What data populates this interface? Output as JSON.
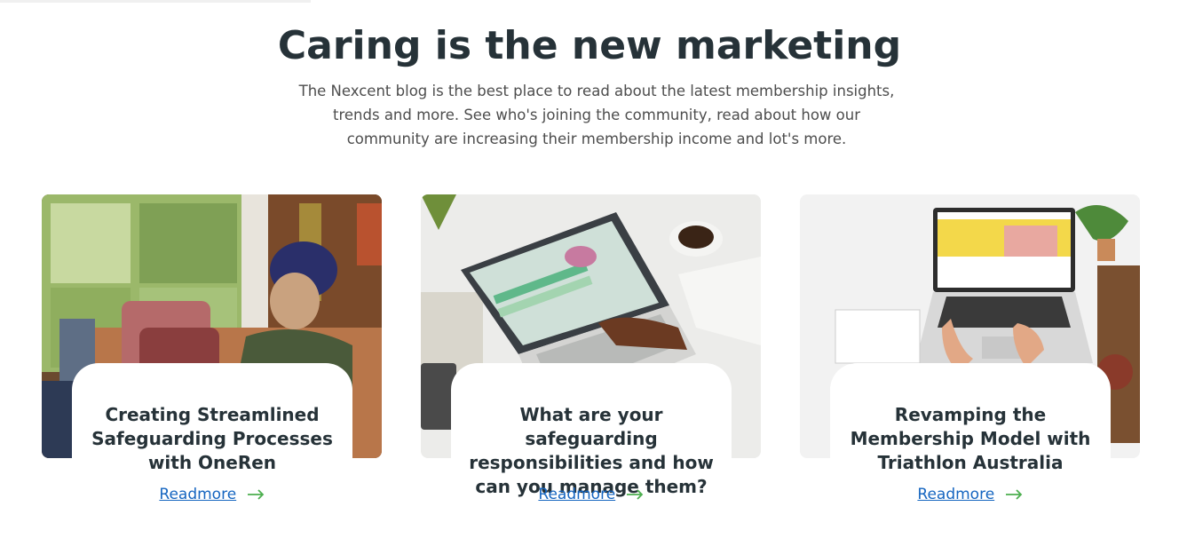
{
  "section": {
    "title": "Caring is the new marketing",
    "subtitle": "The Nexcent blog is the best place to read about the latest membership insights, trends and more. See who's joining the community, read about how our community are increasing their membership income and lot's more."
  },
  "cards": [
    {
      "title": "Creating Streamlined Safeguarding Processes with OneRen",
      "link_label": "Readmore"
    },
    {
      "title": "What are your safeguarding responsibilities and how can you manage them?",
      "link_label": "Readmore"
    },
    {
      "title": "Revamping the Membership Model with Triathlon Australia",
      "link_label": "Readmore"
    }
  ],
  "icons": {
    "readmore_arrow": "arrow-right-icon"
  },
  "colors": {
    "link": "#1565c0",
    "arrow": "#4caf4f",
    "heading": "#263238"
  }
}
